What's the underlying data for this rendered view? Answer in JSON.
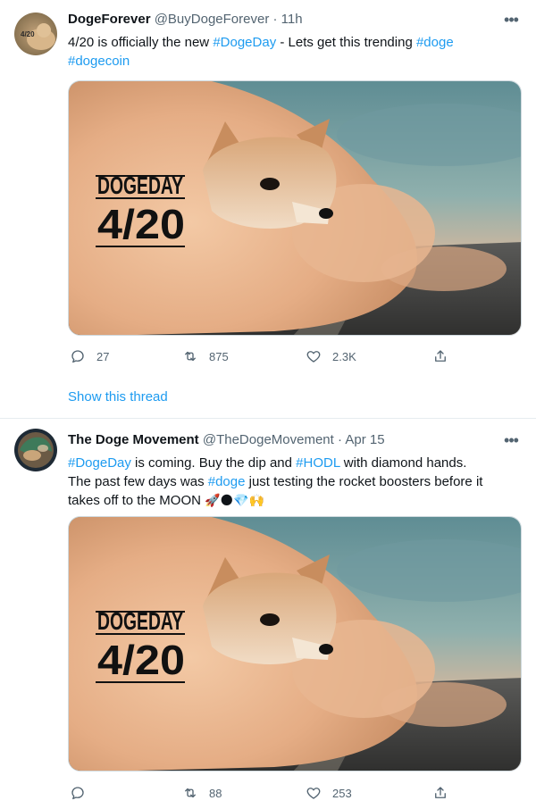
{
  "tweets": [
    {
      "display_name": "DogeForever",
      "handle": "@BuyDogeForever",
      "separator": "·",
      "time": "11h",
      "avatar_text": "4/20",
      "text": {
        "p1": "4/20 is officially the new ",
        "tag1": "#DogeDay",
        "p2": " - Lets get this trending ",
        "tag2": "#doge",
        "tag3": "#dogecoin"
      },
      "media": {
        "line1": "DOGEDAY",
        "line2": "4/20"
      },
      "counts": {
        "reply": "27",
        "retweet": "875",
        "like": "2.3K"
      },
      "show_thread": "Show this thread"
    },
    {
      "display_name": "The Doge Movement",
      "handle": "@TheDogeMovement",
      "separator": "·",
      "time": "Apr 15",
      "text": {
        "tag1": "#DogeDay",
        "p1": " is coming. Buy the dip and ",
        "tag2": "#HODL",
        "p2": " with diamond hands.",
        "p3": "The past few days was ",
        "tag3": "#doge",
        "p4": " just testing the rocket boosters before it takes off to the MOON ",
        "emojis": "🚀🌑💎🙌"
      },
      "media": {
        "line1": "DOGEDAY",
        "line2": "4/20"
      },
      "counts": {
        "reply": "",
        "retweet": "88",
        "like": "253"
      }
    }
  ],
  "icons": {
    "more": "more-dots-icon",
    "reply": "reply-bubble-icon",
    "retweet": "retweet-arrows-icon",
    "like": "heart-icon",
    "share": "share-upload-icon"
  },
  "colors": {
    "link": "#1d9bf0",
    "secondary_text": "#536471",
    "primary_text": "#0f1419",
    "divider": "#e6ecf0"
  }
}
